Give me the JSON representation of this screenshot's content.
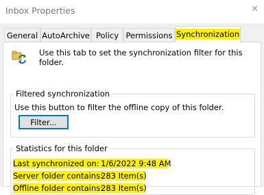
{
  "window": {
    "title": "Inbox Properties",
    "close_glyph": "✕"
  },
  "tabs": [
    {
      "label": "General"
    },
    {
      "label": "AutoArchive"
    },
    {
      "label": "Policy"
    },
    {
      "label": "Permissions"
    },
    {
      "label": "Synchronization",
      "active": true
    }
  ],
  "intro": {
    "icon": "sync-folder-icon",
    "text": "Use this tab to set the synchronization filter for this folder."
  },
  "filtered": {
    "legend": "Filtered synchronization",
    "text": "Use this button to filter the offline copy of this folder.",
    "button_label": "Filter..."
  },
  "stats": {
    "legend": "Statistics for this folder",
    "last_sync_label": "Last synchronized on:",
    "last_sync_value": "1/6/2022 9:48 AM",
    "server_label": "Server folder contains:",
    "server_value": "283 Item(s)",
    "offline_label": "Offline folder contains:",
    "offline_value": "283 Item(s)"
  },
  "colors": {
    "highlight": "#fff200",
    "dialog_bg": "#f0f0f0",
    "focus_border": "#0078d7"
  }
}
